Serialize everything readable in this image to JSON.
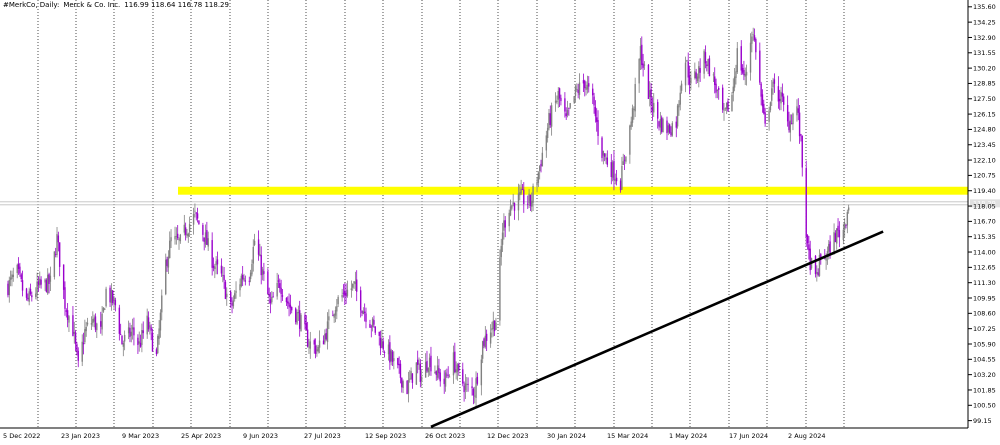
{
  "header": {
    "symbol": "#MerkCo, Daily:",
    "name": "Merck & Co. Inc.",
    "ohlc": "116.99 118.64 116.78 118.29"
  },
  "colors": {
    "background": "#ffffff",
    "bull": "#808080",
    "bear": "#9900cc",
    "grid": "#000000",
    "zone": "#ffff00",
    "trendline": "#000000",
    "price_marker": "#c0c0c0"
  },
  "chart_data": {
    "type": "candlestick",
    "title": "#MerkCo, Daily: Merck & Co. Inc.",
    "y_axis_ticks": [
      "135.60",
      "134.25",
      "132.90",
      "131.55",
      "130.20",
      "128.85",
      "127.50",
      "126.15",
      "124.80",
      "123.45",
      "122.10",
      "120.75",
      "119.40",
      "118.05",
      "116.70",
      "115.35",
      "114.00",
      "112.65",
      "111.30",
      "109.95",
      "108.60",
      "107.25",
      "105.90",
      "104.55",
      "103.20",
      "101.85",
      "100.50",
      "99.15"
    ],
    "ylim": [
      98.5,
      136.2
    ],
    "x_axis_labels": [
      "5 Dec 2022",
      "23 Jan 2023",
      "9 Mar 2023",
      "25 Apr 2023",
      "9 Jun 2023",
      "27 Jul 2023",
      "12 Sep 2023",
      "26 Oct 2023",
      "12 Dec 2023",
      "30 Jan 2024",
      "15 Mar 2024",
      "1 May 2024",
      "17 Jun 2024",
      "2 Aug 2024"
    ],
    "current_price_label": "118.29",
    "resistance_zone": {
      "low": 119.05,
      "high": 119.75
    },
    "trendline": {
      "start": {
        "date": "2023-10-20",
        "price": 98.6
      },
      "end": {
        "date": "2024-09-25",
        "price": 115.8
      }
    },
    "price_path": [
      [
        "2022-12-05",
        111.0
      ],
      [
        "2022-12-12",
        112.2
      ],
      [
        "2022-12-19",
        109.6
      ],
      [
        "2022-12-28",
        110.9
      ],
      [
        "2023-01-06",
        111.3
      ],
      [
        "2023-01-11",
        115.2
      ],
      [
        "2023-01-17",
        109.5
      ],
      [
        "2023-01-23",
        107.2
      ],
      [
        "2023-01-27",
        103.8
      ],
      [
        "2023-02-01",
        107.0
      ],
      [
        "2023-02-07",
        108.0
      ],
      [
        "2023-02-13",
        106.9
      ],
      [
        "2023-02-17",
        110.6
      ],
      [
        "2023-02-24",
        109.3
      ],
      [
        "2023-03-01",
        106.0
      ],
      [
        "2023-03-09",
        107.0
      ],
      [
        "2023-03-14",
        105.8
      ],
      [
        "2023-03-20",
        107.8
      ],
      [
        "2023-03-27",
        104.7
      ],
      [
        "2023-04-03",
        113.0
      ],
      [
        "2023-04-07",
        115.0
      ],
      [
        "2023-04-14",
        114.8
      ],
      [
        "2023-04-18",
        116.0
      ],
      [
        "2023-04-25",
        117.2
      ],
      [
        "2023-05-02",
        115.5
      ],
      [
        "2023-05-09",
        113.0
      ],
      [
        "2023-05-15",
        111.8
      ],
      [
        "2023-05-22",
        109.0
      ],
      [
        "2023-05-30",
        111.8
      ],
      [
        "2023-06-05",
        112.1
      ],
      [
        "2023-06-09",
        115.0
      ],
      [
        "2023-06-14",
        112.6
      ],
      [
        "2023-06-21",
        109.2
      ],
      [
        "2023-06-28",
        111.3
      ],
      [
        "2023-07-05",
        109.3
      ],
      [
        "2023-07-12",
        108.3
      ],
      [
        "2023-07-20",
        106.0
      ],
      [
        "2023-07-27",
        105.4
      ],
      [
        "2023-08-02",
        107.0
      ],
      [
        "2023-08-09",
        109.5
      ],
      [
        "2023-08-16",
        110.4
      ],
      [
        "2023-08-23",
        111.0
      ],
      [
        "2023-08-30",
        109.0
      ],
      [
        "2023-09-06",
        107.5
      ],
      [
        "2023-09-12",
        106.2
      ],
      [
        "2023-09-18",
        105.1
      ],
      [
        "2023-09-25",
        103.5
      ],
      [
        "2023-10-02",
        102.0
      ],
      [
        "2023-10-09",
        104.0
      ],
      [
        "2023-10-13",
        103.0
      ],
      [
        "2023-10-18",
        104.6
      ],
      [
        "2023-10-24",
        103.5
      ],
      [
        "2023-10-30",
        102.5
      ],
      [
        "2023-11-06",
        104.5
      ],
      [
        "2023-11-10",
        103.0
      ],
      [
        "2023-11-16",
        102.0
      ],
      [
        "2023-11-22",
        101.8
      ],
      [
        "2023-11-28",
        106.0
      ],
      [
        "2023-12-01",
        106.6
      ],
      [
        "2023-12-05",
        107.5
      ],
      [
        "2023-12-08",
        108.0
      ],
      [
        "2023-12-13",
        116.0
      ],
      [
        "2023-12-18",
        118.0
      ],
      [
        "2023-12-27",
        118.8
      ],
      [
        "2024-01-03",
        118.3
      ],
      [
        "2024-01-09",
        121.0
      ],
      [
        "2024-01-17",
        125.5
      ],
      [
        "2024-01-24",
        127.8
      ],
      [
        "2024-01-30",
        125.5
      ],
      [
        "2024-02-06",
        128.0
      ],
      [
        "2024-02-13",
        129.0
      ],
      [
        "2024-02-19",
        127.2
      ],
      [
        "2024-02-26",
        122.8
      ],
      [
        "2024-03-04",
        121.4
      ],
      [
        "2024-03-11",
        120.2
      ],
      [
        "2024-03-15",
        123.0
      ],
      [
        "2024-03-20",
        126.2
      ],
      [
        "2024-03-26",
        131.7
      ],
      [
        "2024-04-02",
        127.5
      ],
      [
        "2024-04-09",
        125.5
      ],
      [
        "2024-04-16",
        124.8
      ],
      [
        "2024-04-22",
        125.5
      ],
      [
        "2024-04-28",
        131.5
      ],
      [
        "2024-05-03",
        128.8
      ],
      [
        "2024-05-09",
        130.0
      ],
      [
        "2024-05-14",
        131.2
      ],
      [
        "2024-05-21",
        128.8
      ],
      [
        "2024-05-28",
        125.8
      ],
      [
        "2024-06-03",
        127.8
      ],
      [
        "2024-06-07",
        131.5
      ],
      [
        "2024-06-13",
        129.2
      ],
      [
        "2024-06-18",
        133.5
      ],
      [
        "2024-06-21",
        132.0
      ],
      [
        "2024-06-26",
        126.5
      ],
      [
        "2024-06-28",
        124.8
      ],
      [
        "2024-07-03",
        128.5
      ],
      [
        "2024-07-10",
        127.6
      ],
      [
        "2024-07-15",
        125.2
      ],
      [
        "2024-07-22",
        126.8
      ],
      [
        "2024-07-25",
        123.5
      ],
      [
        "2024-07-30",
        114.0
      ],
      [
        "2024-08-05",
        111.5
      ],
      [
        "2024-08-09",
        113.5
      ],
      [
        "2024-08-14",
        113.8
      ],
      [
        "2024-08-20",
        115.5
      ],
      [
        "2024-08-26",
        116.0
      ],
      [
        "2024-08-30",
        118.3
      ]
    ]
  }
}
